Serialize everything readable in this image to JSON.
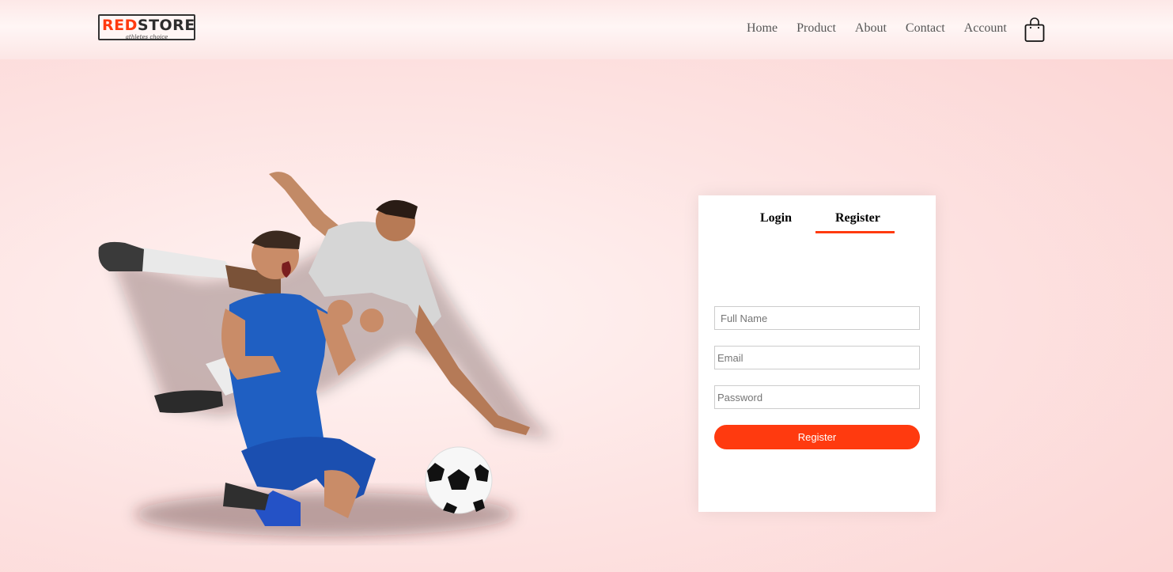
{
  "brand": {
    "name_red": "RED",
    "name_dark": "STORE",
    "tagline": "athletes choice"
  },
  "nav": {
    "items": [
      {
        "label": "Home"
      },
      {
        "label": "Product"
      },
      {
        "label": "About"
      },
      {
        "label": "Contact"
      },
      {
        "label": "Account"
      }
    ],
    "cart_icon": "shopping-bag-icon"
  },
  "hero": {
    "image": "soccer-players-illustration"
  },
  "form": {
    "tabs": [
      {
        "label": "Login",
        "active": false
      },
      {
        "label": "Register",
        "active": true
      }
    ],
    "fields": {
      "full_name_placeholder": "Full Name",
      "email_placeholder": "Email",
      "password_placeholder": "Password"
    },
    "submit_label": "Register"
  },
  "colors": {
    "accent": "#ff3a0f",
    "background": "#fde0df"
  }
}
